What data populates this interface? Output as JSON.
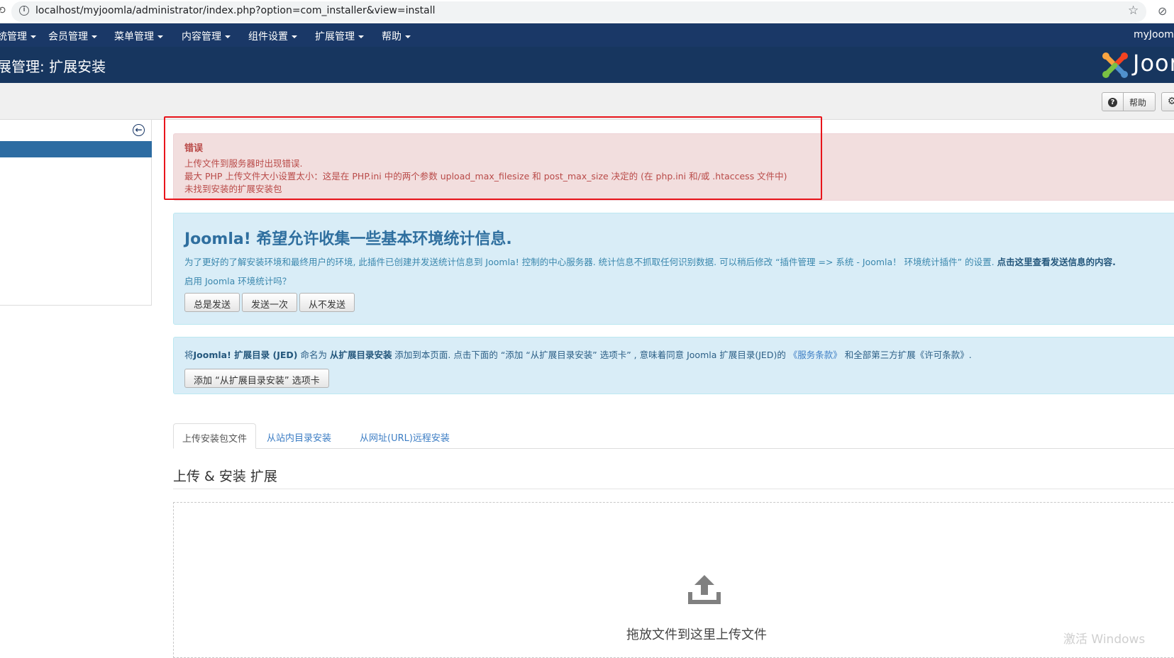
{
  "browser": {
    "url": "localhost/myjoomla/administrator/index.php?option=com_installer&view=install"
  },
  "menubar": {
    "items": [
      "统管理",
      "会员管理",
      "菜单管理",
      "内容管理",
      "组件设置",
      "扩展管理",
      "帮助"
    ],
    "user": "myJoomla"
  },
  "header": {
    "title": "展管理: 扩展安装",
    "brand": "Joomla!"
  },
  "toolbar": {
    "help_label": "帮助"
  },
  "error_alert": {
    "heading": "错误",
    "lines": [
      "上传文件到服务器时出现错误.",
      "最大 PHP 上传文件大小设置太小：这是在 PHP.ini 中的两个参数 upload_max_filesize 和 post_max_size 决定的 (在 php.ini 和/或 .htaccess 文件中)",
      "未找到安装的扩展安装包"
    ]
  },
  "stats_message": {
    "heading": "Joomla! 希望允许收集一些基本环境统计信息.",
    "text": "为了更好的了解安装环境和最终用户的环境, 此插件已创建并发送统计信息到 Joomla! 控制的中心服务器. 统计信息不抓取任何识别数据. 可以稍后修改 “插件管理 => 系统 - Joomla！ 环境统计插件” 的设置.",
    "link": "点击这里查看发送信息的内容.",
    "question": "启用 Joomla 环境统计吗？",
    "buttons": [
      "总是发送",
      "发送一次",
      "从不发送"
    ]
  },
  "jed_message": {
    "t1": "将",
    "b1": "Joomla! 扩展目录 (JED)",
    "t2": " 命名为 ",
    "b2": "从扩展目录安装",
    "t3": " 添加到本页面. 点击下面的 “添加 “从扩展目录安装” 选项卡” , 意味着同意 Joomla 扩展目录(JED)的 ",
    "a1": "《服务条款》",
    "t4": " 和全部第三方扩展《许可条款》.",
    "button": "添加 “从扩展目录安装” 选项卡"
  },
  "tabs": [
    "上传安装包文件",
    "从站内目录安装",
    "从网址(URL)远程安装"
  ],
  "section": {
    "title": "上传 & 安装 扩展",
    "drop_text": "拖放文件到这里上传文件",
    "watermark": "激活 Windows"
  }
}
